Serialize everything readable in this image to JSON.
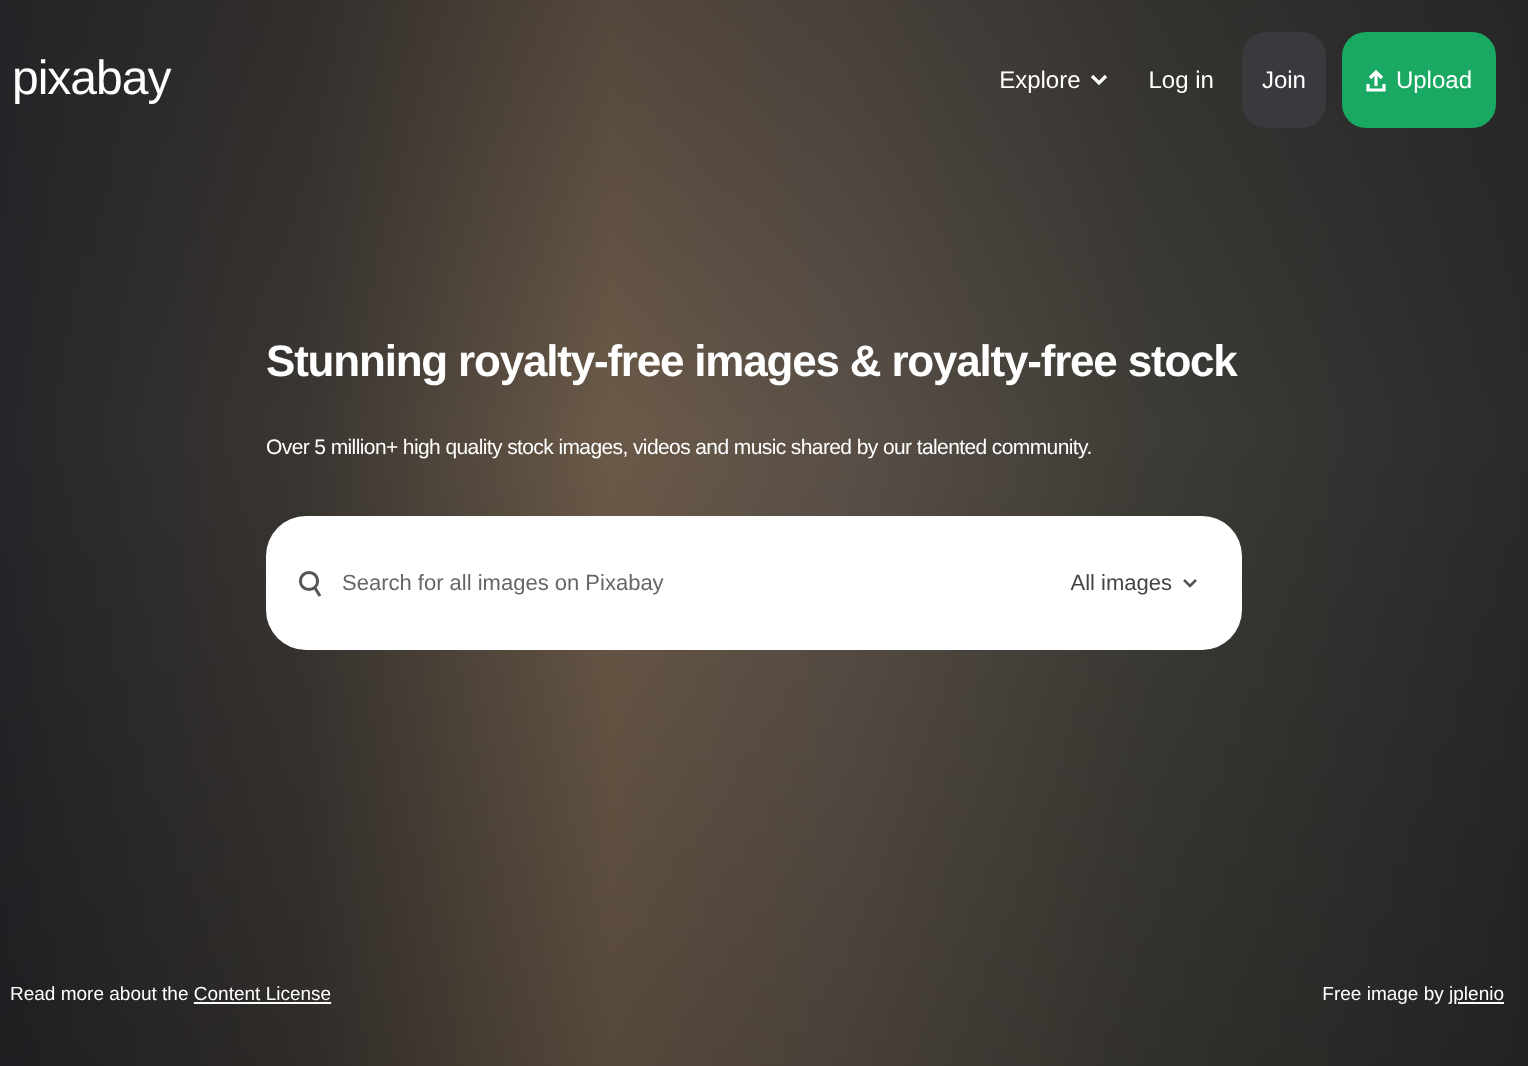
{
  "header": {
    "logo": "pixabay",
    "nav": [
      {
        "label": "Explore",
        "kind": "menu"
      },
      {
        "label": "Log in",
        "kind": "link"
      },
      {
        "label": "Join",
        "kind": "join"
      },
      {
        "label": "Upload",
        "kind": "upload"
      }
    ]
  },
  "hero": {
    "title": "Stunning royalty-free images & royalty-free stock",
    "subtitle": "Over 5 million+ high quality stock images, videos and music shared by our talented community.",
    "search": {
      "placeholder": "Search for all images on Pixabay",
      "filter": "All images"
    }
  },
  "footer": {
    "license_text": "Read more about the",
    "license_link": "Content License",
    "credit_text": "Free image by",
    "credit_link": "jplenio"
  }
}
